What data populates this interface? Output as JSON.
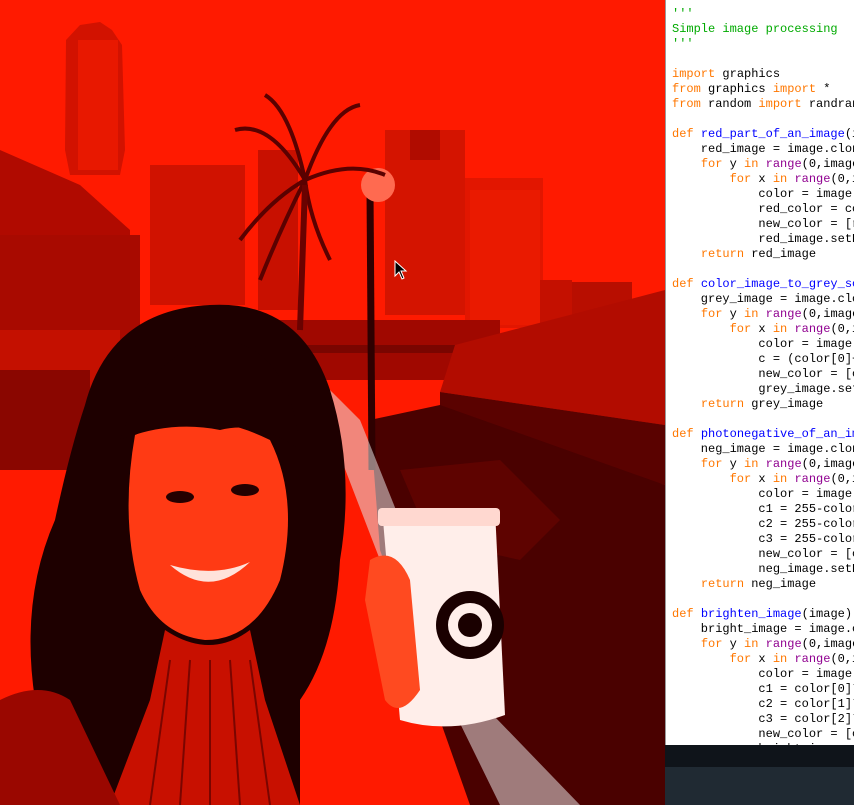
{
  "code_lines": [
    {
      "text": "'''",
      "cls": "st"
    },
    {
      "text": "'''",
      "cls": "st"
    },
    {
      "text": "Simple image processing",
      "cls": "st"
    },
    {
      "text": "'''",
      "cls": "st"
    },
    {
      "text": "",
      "cls": ""
    },
    {
      "text": "import graphics",
      "cls": "",
      "kw": [
        "import"
      ]
    },
    {
      "text": "from graphics import *",
      "cls": "",
      "kw": [
        "from",
        "import"
      ]
    },
    {
      "text": "from random import randrange",
      "cls": "",
      "kw": [
        "from",
        "import"
      ]
    },
    {
      "text": "",
      "cls": ""
    },
    {
      "text": "def red_part_of_an_image(image):",
      "cls": "def"
    },
    {
      "text": "    red_image = image.clone()",
      "cls": ""
    },
    {
      "text": "    for y in range(0,image",
      "cls": "loop"
    },
    {
      "text": "        for x in range(0,im",
      "cls": "loop"
    },
    {
      "text": "            color = image.g",
      "cls": ""
    },
    {
      "text": "            red_color = col",
      "cls": ""
    },
    {
      "text": "            new_color = [re",
      "cls": ""
    },
    {
      "text": "            red_image.setPi",
      "cls": ""
    },
    {
      "text": "    return red_image",
      "cls": "ret"
    },
    {
      "text": "",
      "cls": ""
    },
    {
      "text": "def color_image_to_grey_scale(image):",
      "cls": "def"
    },
    {
      "text": "    grey_image = image.clone()",
      "cls": ""
    },
    {
      "text": "    for y in range(0,image",
      "cls": "loop"
    },
    {
      "text": "        for x in range(0,im",
      "cls": "loop"
    },
    {
      "text": "            color = image.g",
      "cls": ""
    },
    {
      "text": "            c = (color[0]+c",
      "cls": ""
    },
    {
      "text": "            new_color = [c,",
      "cls": ""
    },
    {
      "text": "            grey_image.setP",
      "cls": ""
    },
    {
      "text": "    return grey_image",
      "cls": "ret"
    },
    {
      "text": "",
      "cls": ""
    },
    {
      "text": "def photonegative_of_an_image(image):",
      "cls": "def"
    },
    {
      "text": "    neg_image = image.clone()",
      "cls": ""
    },
    {
      "text": "    for y in range(0,image",
      "cls": "loop"
    },
    {
      "text": "        for x in range(0,im",
      "cls": "loop"
    },
    {
      "text": "            color = image.g",
      "cls": ""
    },
    {
      "text": "            c1 = 255-color[",
      "cls": ""
    },
    {
      "text": "            c2 = 255-color[",
      "cls": ""
    },
    {
      "text": "            c3 = 255-color[",
      "cls": ""
    },
    {
      "text": "            new_color = [c1",
      "cls": ""
    },
    {
      "text": "            neg_image.setPi",
      "cls": ""
    },
    {
      "text": "    return neg_image",
      "cls": "ret"
    },
    {
      "text": "",
      "cls": ""
    },
    {
      "text": "def brighten_image(image):",
      "cls": "def"
    },
    {
      "text": "    bright_image = image.cl",
      "cls": ""
    },
    {
      "text": "    for y in range(0,image",
      "cls": "loop"
    },
    {
      "text": "        for x in range(0,im",
      "cls": "loop"
    },
    {
      "text": "            color = image.g",
      "cls": ""
    },
    {
      "text": "            c1 = color[0]*",
      "cls": ""
    },
    {
      "text": "            c2 = color[1]*",
      "cls": ""
    },
    {
      "text": "            c3 = color[2]*",
      "cls": ""
    },
    {
      "text": "            new_color = [c",
      "cls": ""
    },
    {
      "text": "            bright_image",
      "cls": ""
    }
  ],
  "colors": {
    "image_tint": "#ff1a00",
    "keyword": "#ff7700",
    "function_name": "#0000ff",
    "builtin": "#900090",
    "string": "#00aa00"
  }
}
